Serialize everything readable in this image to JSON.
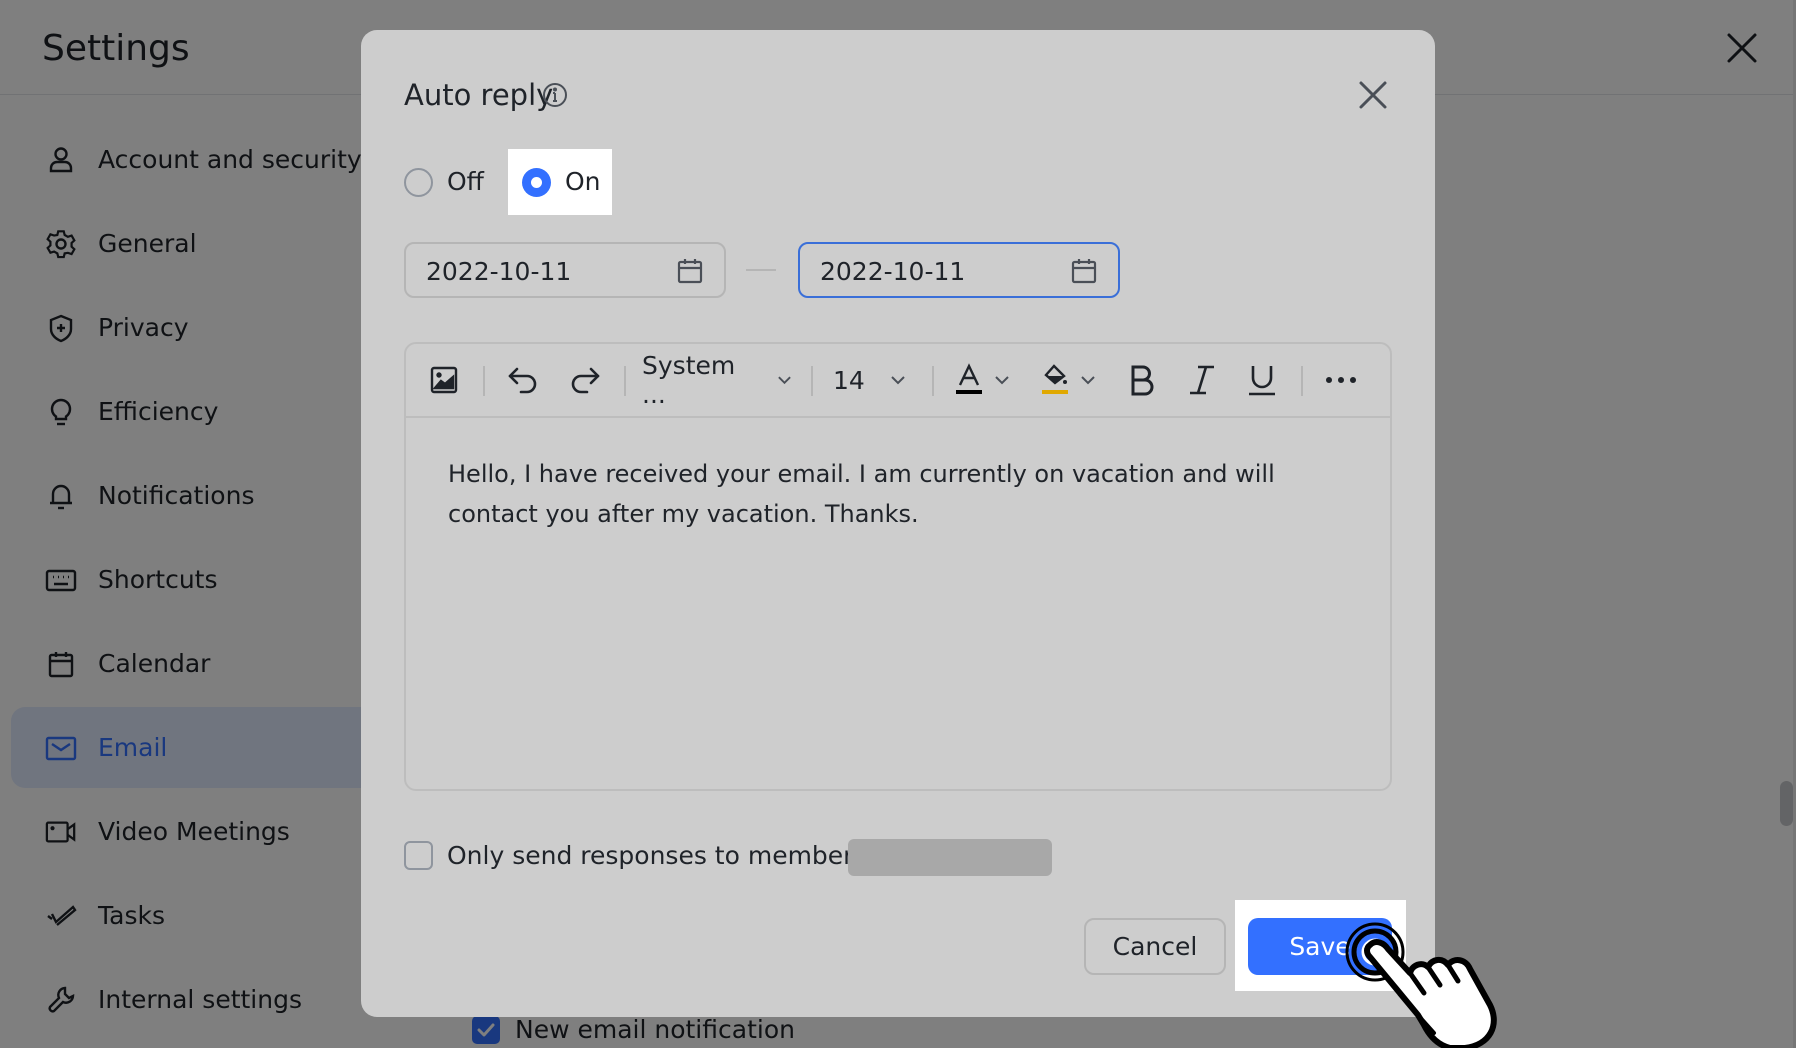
{
  "settings": {
    "title": "Settings",
    "sidebar": {
      "items": [
        {
          "label": "Account and security",
          "icon": "user-icon"
        },
        {
          "label": "General",
          "icon": "gear-icon"
        },
        {
          "label": "Privacy",
          "icon": "shield-icon"
        },
        {
          "label": "Efficiency",
          "icon": "lightbulb-icon"
        },
        {
          "label": "Notifications",
          "icon": "bell-icon"
        },
        {
          "label": "Shortcuts",
          "icon": "keyboard-icon"
        },
        {
          "label": "Calendar",
          "icon": "calendar-icon"
        },
        {
          "label": "Email",
          "icon": "mail-icon",
          "active": true
        },
        {
          "label": "Video Meetings",
          "icon": "video-icon"
        },
        {
          "label": "Tasks",
          "icon": "tasks-icon"
        },
        {
          "label": "Internal settings",
          "icon": "wrench-icon"
        }
      ]
    },
    "background_content": {
      "new_email_notification_label": "New email notification",
      "new_email_notification_checked": true
    }
  },
  "modal": {
    "title": "Auto reply",
    "radio": {
      "off_label": "Off",
      "on_label": "On",
      "selected": "On"
    },
    "date_range": {
      "start": "2022-10-11",
      "end": "2022-10-11"
    },
    "toolbar": {
      "font_family": "System ...",
      "font_size": "14",
      "text_color": "#000000",
      "highlight_color": "#e0a800"
    },
    "body_text": "Hello, I have received your email. I am currently on vacation and will contact you after my vacation. Thanks.",
    "members_only": {
      "label": "Only send responses to members of",
      "checked": false
    },
    "buttons": {
      "cancel": "Cancel",
      "save": "Save"
    }
  },
  "colors": {
    "accent": "#3370ff"
  }
}
